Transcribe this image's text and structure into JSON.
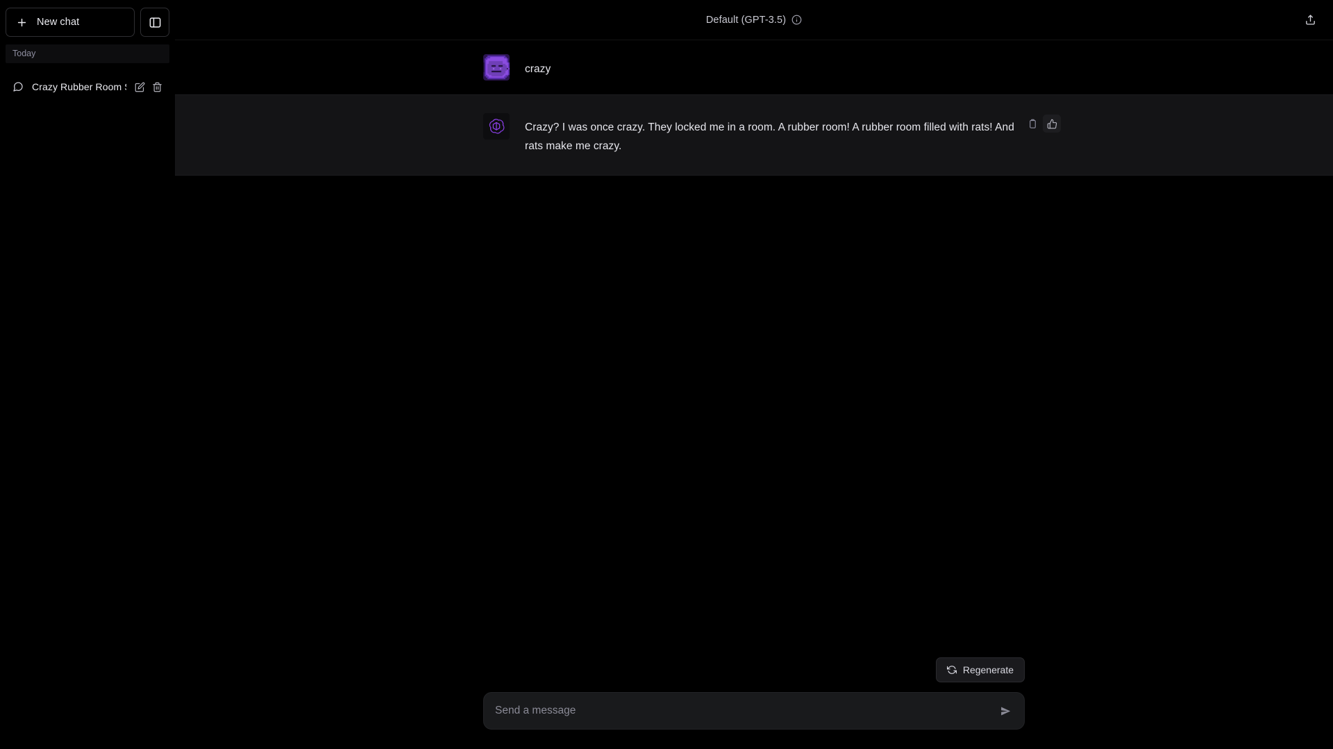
{
  "sidebar": {
    "new_chat_label": "New chat",
    "new_chat_icon": "plus-icon",
    "toggle_icon": "sidebar-panel-icon",
    "section_label": "Today",
    "chats": [
      {
        "title": "Crazy Rubber Room S…",
        "icon": "chat-bubble-icon",
        "edit_icon": "pencil-icon",
        "delete_icon": "trash-icon"
      }
    ]
  },
  "header": {
    "model_label": "Default (GPT-3.5)",
    "info_icon": "info-circle-icon",
    "share_icon": "share-upload-icon"
  },
  "conversation": {
    "messages": [
      {
        "role": "user",
        "author": "crazy",
        "avatar": "user-avatar-image",
        "text": "crazy"
      },
      {
        "role": "assistant",
        "avatar": "openai-logo-icon",
        "text": "Crazy? I was once crazy. They locked me in a room. A rubber room! A rubber room filled with rats! And rats make me crazy.",
        "actions": [
          {
            "name": "copy-icon",
            "label": "Copy",
            "active": false
          },
          {
            "name": "thumbs-up-icon",
            "label": "Good response",
            "active": true
          }
        ]
      }
    ]
  },
  "composer": {
    "regenerate_label": "Regenerate",
    "regenerate_icon": "refresh-icon",
    "placeholder": "Send a message",
    "value": "",
    "send_icon": "send-arrow-icon"
  },
  "colors": {
    "background": "#000000",
    "assistant_bg": "#141416",
    "accent_purple": "#8b3fe8",
    "text": "#ececf1",
    "muted": "#8e8ea0"
  }
}
